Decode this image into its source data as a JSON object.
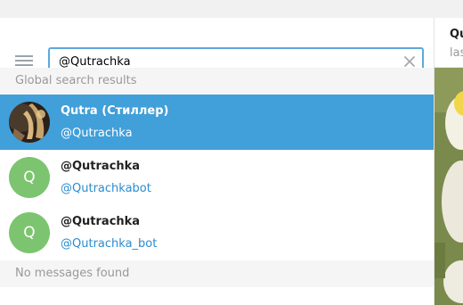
{
  "search": {
    "query": "@Qutrachka",
    "clear_icon": "close-icon",
    "menu_icon": "hamburger-icon"
  },
  "global_results": {
    "header": "Global search results",
    "items": [
      {
        "title": "Qutra (Стиллер)",
        "subtitle": "@Qutrachka",
        "avatar": "photo",
        "selected": true
      },
      {
        "title": "@Qutrachka",
        "subtitle": "@Qutrachkabot",
        "avatar_letter": "Q",
        "selected": false
      },
      {
        "title": "@Qutrachka",
        "subtitle": "@Qutrachka_bot",
        "avatar_letter": "Q",
        "selected": false
      }
    ]
  },
  "messages": {
    "empty_text": "No messages found"
  },
  "chat": {
    "name": "Qu",
    "status": "las"
  },
  "colors": {
    "accent": "#419fd9",
    "link": "#2a8ccf",
    "avatar_green": "#7cc46f",
    "search_border": "#5ca9dd",
    "section_bg": "#f5f5f5"
  }
}
